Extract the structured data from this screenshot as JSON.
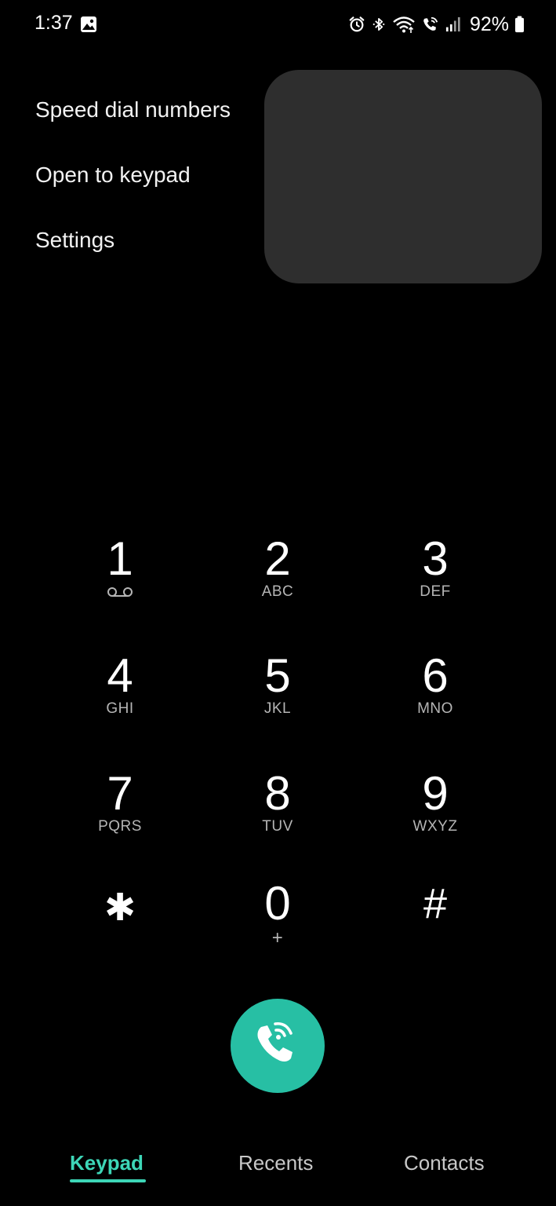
{
  "status_bar": {
    "time": "1:37",
    "battery": "92%",
    "icons": [
      "gallery-icon",
      "alarm-icon",
      "bluetooth-icon",
      "wifi-icon",
      "wifi-calling-icon",
      "signal-icon",
      "battery-icon"
    ]
  },
  "menu": {
    "items": [
      {
        "label": "Speed dial numbers"
      },
      {
        "label": "Open to keypad"
      },
      {
        "label": "Settings"
      }
    ]
  },
  "keypad": {
    "keys": [
      {
        "digit": "1",
        "letters": "",
        "icon": "voicemail-icon"
      },
      {
        "digit": "2",
        "letters": "ABC"
      },
      {
        "digit": "3",
        "letters": "DEF"
      },
      {
        "digit": "4",
        "letters": "GHI"
      },
      {
        "digit": "5",
        "letters": "JKL"
      },
      {
        "digit": "6",
        "letters": "MNO"
      },
      {
        "digit": "7",
        "letters": "PQRS"
      },
      {
        "digit": "8",
        "letters": "TUV"
      },
      {
        "digit": "9",
        "letters": "WXYZ"
      },
      {
        "digit": "✱",
        "letters": ""
      },
      {
        "digit": "0",
        "letters": "+"
      },
      {
        "digit": "#",
        "letters": ""
      }
    ]
  },
  "call_button": {
    "icon": "wifi-call-icon",
    "color": "#27bfa4"
  },
  "tabs": [
    {
      "label": "Keypad",
      "active": true
    },
    {
      "label": "Recents",
      "active": false
    },
    {
      "label": "Contacts",
      "active": false
    }
  ],
  "colors": {
    "accent": "#3dd6b7",
    "menu_background": "#2e2e2e",
    "background": "#000000"
  }
}
